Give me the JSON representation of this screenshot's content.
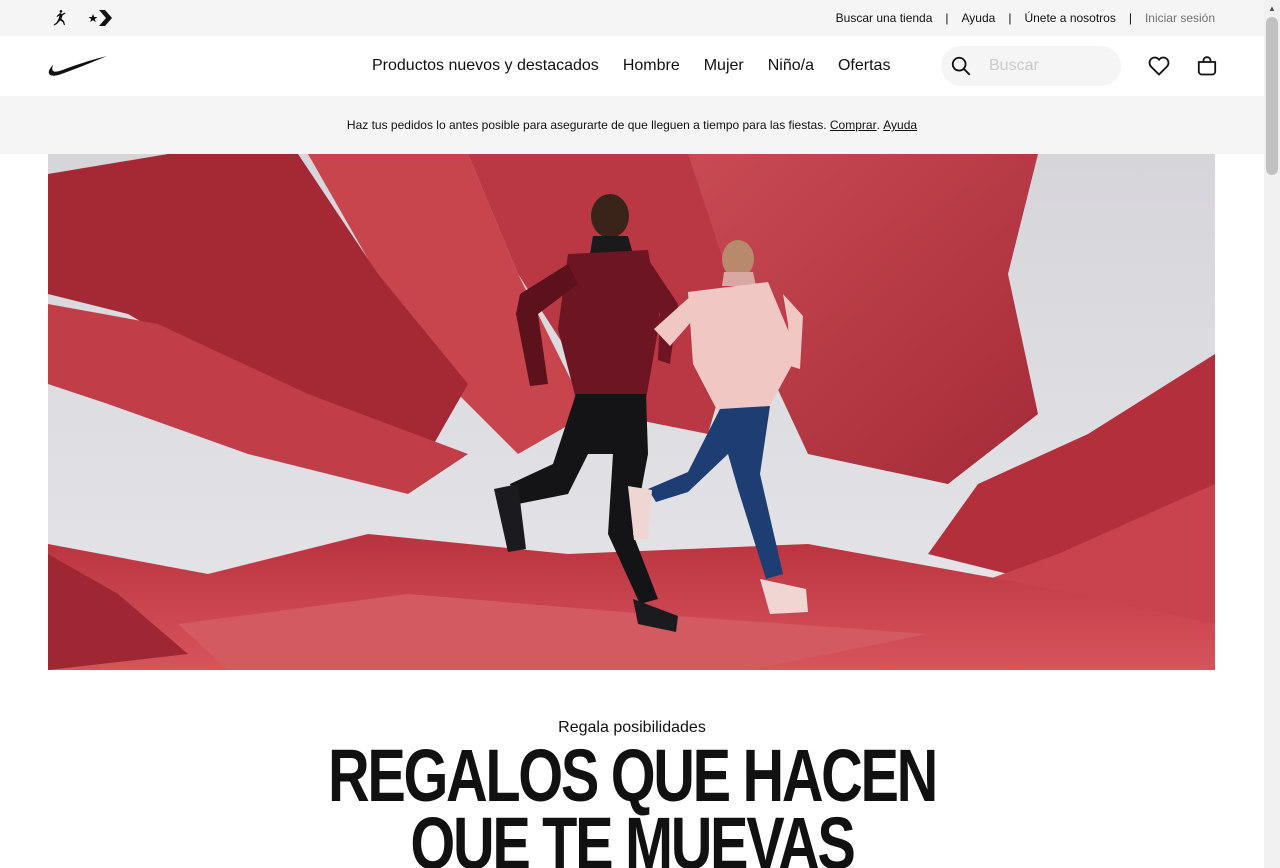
{
  "utility": {
    "brands": [
      {
        "icon": "jordan-jumpman-icon"
      },
      {
        "icon": "converse-star-chevron-icon"
      }
    ],
    "links": {
      "find_store": "Buscar una tienda",
      "help": "Ayuda",
      "join": "Únete a nosotros",
      "sign_in": "Iniciar sesión"
    },
    "separator": "|"
  },
  "nav": {
    "logo_icon": "nike-swoosh-icon",
    "items": [
      {
        "label": "Productos nuevos y destacados"
      },
      {
        "label": "Hombre"
      },
      {
        "label": "Mujer"
      },
      {
        "label": "Niño/a"
      },
      {
        "label": "Ofertas"
      }
    ],
    "search": {
      "placeholder": "Buscar",
      "icon": "search-icon"
    },
    "favorites_icon": "heart-icon",
    "bag_icon": "shopping-bag-icon"
  },
  "promo": {
    "text": "Haz tus pedidos lo antes posible para asegurarte de que lleguen a tiempo para las fiestas.",
    "link_shop": "Comprar",
    "dot": ".",
    "link_help": "Ayuda"
  },
  "hero": {
    "kicker": "Regala posibilidades",
    "headline_line1": "REGALOS QUE HACEN",
    "headline_line2": "QUE TE MUEVAS"
  },
  "colors": {
    "paper_red": "#c23b45",
    "paper_dark": "#8e1f2c",
    "backdrop": "#dcdcdf",
    "text": "#111111",
    "muted": "#707072",
    "surface": "#f5f5f5"
  }
}
